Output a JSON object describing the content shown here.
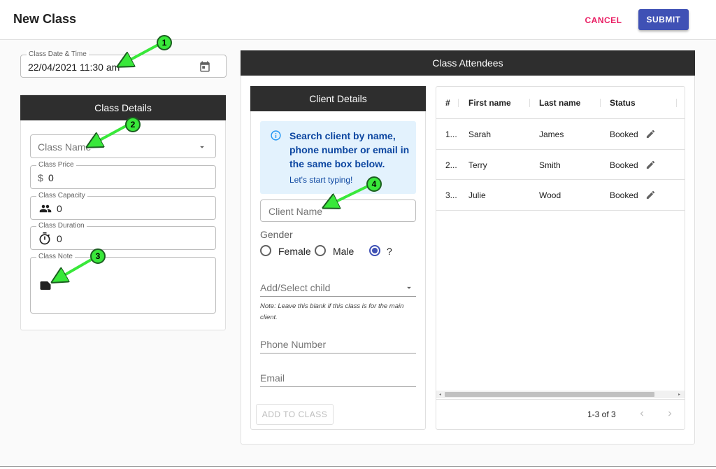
{
  "header": {
    "title": "New Class",
    "cancel_label": "CANCEL",
    "submit_label": "SUBMIT"
  },
  "date_field": {
    "label": "Class Date & Time",
    "value": "22/04/2021 11:30 am"
  },
  "class_details": {
    "title": "Class Details",
    "name_placeholder": "Class Name",
    "price": {
      "label": "Class Price",
      "prefix": "$",
      "value": "0"
    },
    "capacity": {
      "label": "Class Capacity",
      "value": "0"
    },
    "duration": {
      "label": "Class Duration",
      "value": "0"
    },
    "note": {
      "label": "Class Note"
    }
  },
  "attendees_panel": {
    "title": "Class Attendees"
  },
  "client_details": {
    "title": "Client Details",
    "info_text": "Search client by name, phone number or email in the same box below.",
    "info_sub": "Let's start typing!",
    "client_name_placeholder": "Client Name",
    "gender_label": "Gender",
    "gender_options": [
      "Female",
      "Male",
      "?"
    ],
    "gender_selected": "?",
    "child_placeholder": "Add/Select child",
    "child_note": "Note: Leave this blank if this class is for the main client.",
    "phone_placeholder": "Phone Number",
    "email_placeholder": "Email",
    "add_button": "ADD TO CLASS"
  },
  "table": {
    "headers": [
      "#",
      "First name",
      "Last name",
      "Status"
    ],
    "rows": [
      {
        "num": "1...",
        "first": "Sarah",
        "last": "James",
        "status": "Booked"
      },
      {
        "num": "2...",
        "first": "Terry",
        "last": "Smith",
        "status": "Booked"
      },
      {
        "num": "3...",
        "first": "Julie",
        "last": "Wood",
        "status": "Booked"
      }
    ],
    "pagination": "1-3 of 3"
  },
  "annotations": [
    "1",
    "2",
    "3",
    "4"
  ],
  "colors": {
    "primary": "#3f51b5",
    "cancel": "#e91e63",
    "header_dark": "#2e2e2e",
    "info_bg": "#e3f2fd",
    "arrow": "#39e83a"
  },
  "icons": [
    "calendar-icon",
    "dropdown-arrow-icon",
    "people-icon",
    "timer-icon",
    "note-icon",
    "info-icon",
    "edit-icon",
    "chevron-left-icon",
    "chevron-right-icon"
  ]
}
